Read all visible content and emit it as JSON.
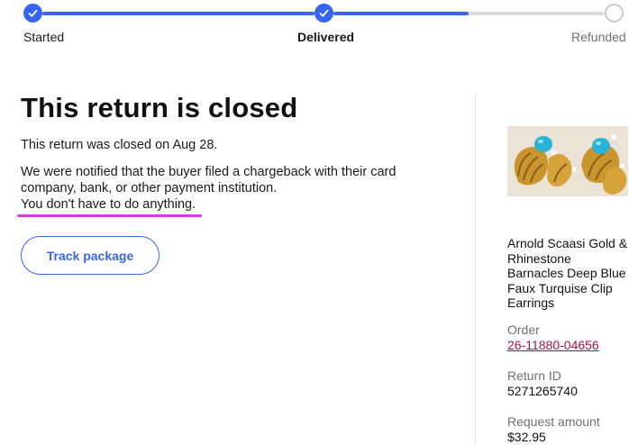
{
  "tracker": {
    "steps": [
      {
        "label": "Started",
        "status": "done"
      },
      {
        "label": "Delivered",
        "status": "done"
      },
      {
        "label": "Refunded",
        "status": "pending"
      }
    ],
    "progress_between_delivered_and_refunded": 0.5,
    "colors": {
      "active": "#3665f3",
      "inactive": "#c7c7c7"
    }
  },
  "main": {
    "title": "This return is closed",
    "closed_line": "This return was closed on Aug 28.",
    "notice_part1": "We were notified that the buyer filed a chargeback with their card company, bank, or other payment institution.",
    "notice_part2": "You don't have to do anything.",
    "track_button": "Track package"
  },
  "side": {
    "item_title": "Arnold Scaasi Gold & Rhinestone Barnacles Deep Blue Faux Turquise Clip Earrings",
    "order_label": "Order",
    "order_value": "26-11880-04656",
    "return_id_label": "Return ID",
    "return_id_value": "5271265740",
    "request_amount_label": "Request amount",
    "request_amount_value": "$32.95"
  },
  "colors": {
    "accent": "#3665f3",
    "link": "#a3124f",
    "highlight": "#d63ae0"
  }
}
